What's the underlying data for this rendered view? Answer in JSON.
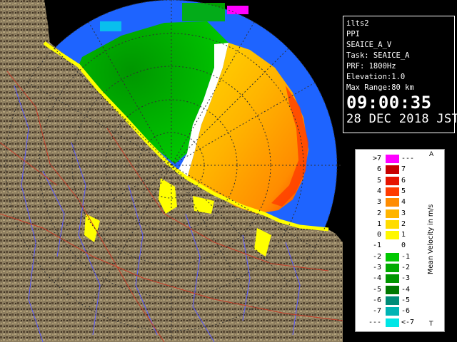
{
  "radar": {
    "station": "ilts2",
    "product": "PPI",
    "scan_name": "SEAICE_A_V",
    "task": "Task: SEAICE_A",
    "prf": "PRF: 1800Hz",
    "elevation": "Elevation:1.0",
    "max_range": "Max Range:80 km",
    "time": "09:00:35",
    "date": "28 DEC 2018 JST"
  },
  "legend": {
    "title": "Mean Velocity in m/s",
    "top_marker": "A",
    "bottom_marker": "T",
    "rows": [
      {
        "left": ">7",
        "right": "---",
        "color": "#ff00ff"
      },
      {
        "left": "6",
        "right": "7",
        "color": "#c80000"
      },
      {
        "left": "5",
        "right": "6",
        "color": "#e61400"
      },
      {
        "left": "4",
        "right": "5",
        "color": "#ff3c00"
      },
      {
        "left": "3",
        "right": "4",
        "color": "#ff8c00"
      },
      {
        "left": "2",
        "right": "3",
        "color": "#ffb400"
      },
      {
        "left": "1",
        "right": "2",
        "color": "#ffdc00"
      },
      {
        "left": "0",
        "right": "1",
        "color": "#fff800"
      },
      {
        "left": "-1",
        "right": "0",
        "color": "#ffffff"
      },
      {
        "left": "-2",
        "right": "-1",
        "color": "#00c800"
      },
      {
        "left": "-3",
        "right": "-2",
        "color": "#00aa00"
      },
      {
        "left": "-4",
        "right": "-3",
        "color": "#009600"
      },
      {
        "left": "-5",
        "right": "-4",
        "color": "#007800"
      },
      {
        "left": "-6",
        "right": "-5",
        "color": "#008c78"
      },
      {
        "left": "-7",
        "right": "-6",
        "color": "#00b4b4"
      },
      {
        "left": "---",
        "right": "<-7",
        "color": "#00e6e6"
      }
    ]
  },
  "colors": {
    "ocean": "#1e64ff",
    "land": "#8c7d5f",
    "river": "#5a5aff",
    "boundary": "#c83c28",
    "coast": "#ffff00",
    "range_ring": "#303030"
  }
}
